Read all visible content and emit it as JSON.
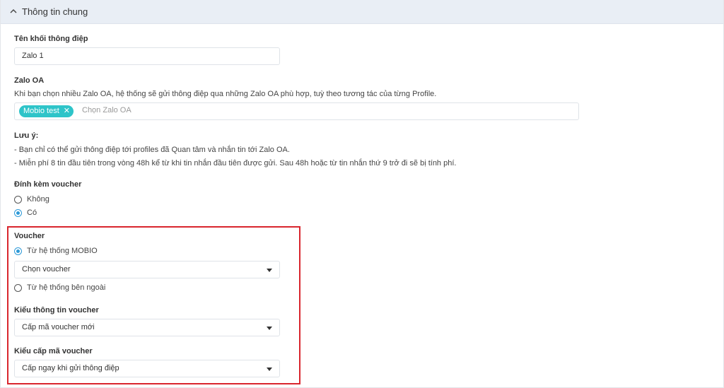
{
  "section": {
    "title": "Thông tin chung"
  },
  "message_block": {
    "label": "Tên khối thông điệp",
    "value": "Zalo 1"
  },
  "zalo_oa": {
    "label": "Zalo OA",
    "description": "Khi bạn chọn nhiều Zalo OA, hệ thống sẽ gửi thông điệp qua những Zalo OA phù hợp, tuỳ theo tương tác của từng Profile.",
    "selected_tag": "Mobio test",
    "remove_symbol": "✕",
    "placeholder": "Chọn Zalo OA"
  },
  "note": {
    "label": "Lưu ý:",
    "lines": [
      "- Bạn chỉ có thể gửi thông điệp tới profiles đã Quan tâm và nhắn tin tới Zalo OA.",
      "- Miễn phí 8 tin đầu tiên trong vòng 48h kể từ khi tin nhắn đầu tiên được gửi. Sau 48h hoặc từ tin nhắn thứ 9 trở đi sẽ bị tính phí."
    ]
  },
  "attach_voucher": {
    "label": "Đính kèm voucher",
    "options": [
      "Không",
      "Có"
    ],
    "selected": "Có"
  },
  "voucher": {
    "label": "Voucher",
    "source_mobio": "Từ hệ thống MOBIO",
    "source_external": "Từ hệ thống bên ngoài",
    "selected_source": "Từ hệ thống MOBIO",
    "select_value": "Chọn voucher"
  },
  "voucher_info_type": {
    "label": "Kiểu thông tin voucher",
    "value": "Cấp mã voucher mới"
  },
  "voucher_code_type": {
    "label": "Kiểu cấp mã voucher",
    "value": "Cấp ngay khi gửi thông điệp"
  },
  "colors": {
    "header_bg": "#e9eef5",
    "tag_bg": "#2ec4c9",
    "radio_accent": "#2e9ad8",
    "highlight_border": "#d9262e"
  },
  "icons": {
    "header_toggle": "chevron-up-icon",
    "select_caret": "caret-down-icon"
  }
}
